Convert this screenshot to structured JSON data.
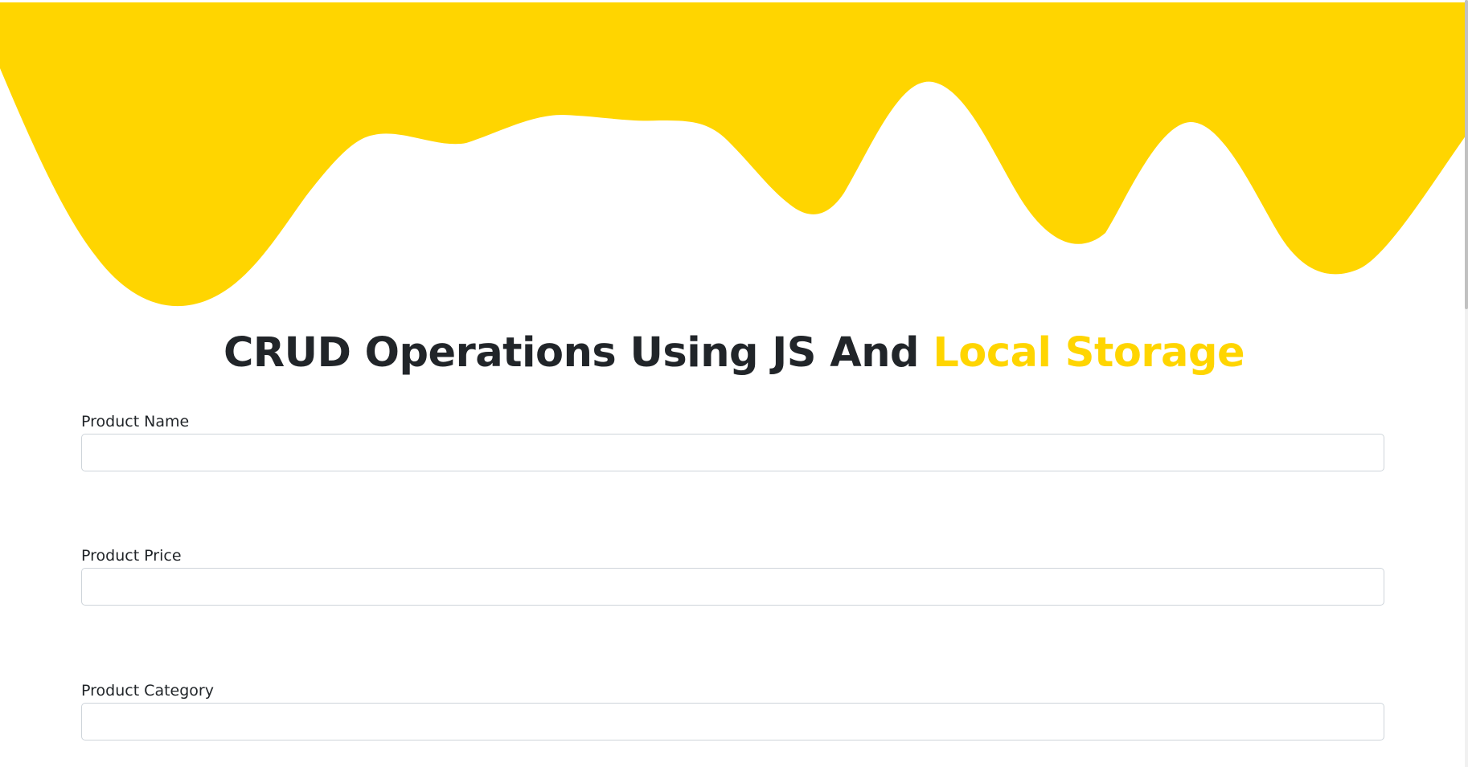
{
  "header": {
    "title_main": "CRUD Operations Using JS And ",
    "title_accent": "Local Storage"
  },
  "form": {
    "fields": [
      {
        "label": "Product Name",
        "value": "",
        "placeholder": ""
      },
      {
        "label": "Product Price",
        "value": "",
        "placeholder": ""
      },
      {
        "label": "Product Category",
        "value": "",
        "placeholder": ""
      }
    ]
  },
  "colors": {
    "accent": "#ffd500",
    "text": "#212529",
    "input_border": "#ced4da",
    "background": "#ffffff"
  }
}
